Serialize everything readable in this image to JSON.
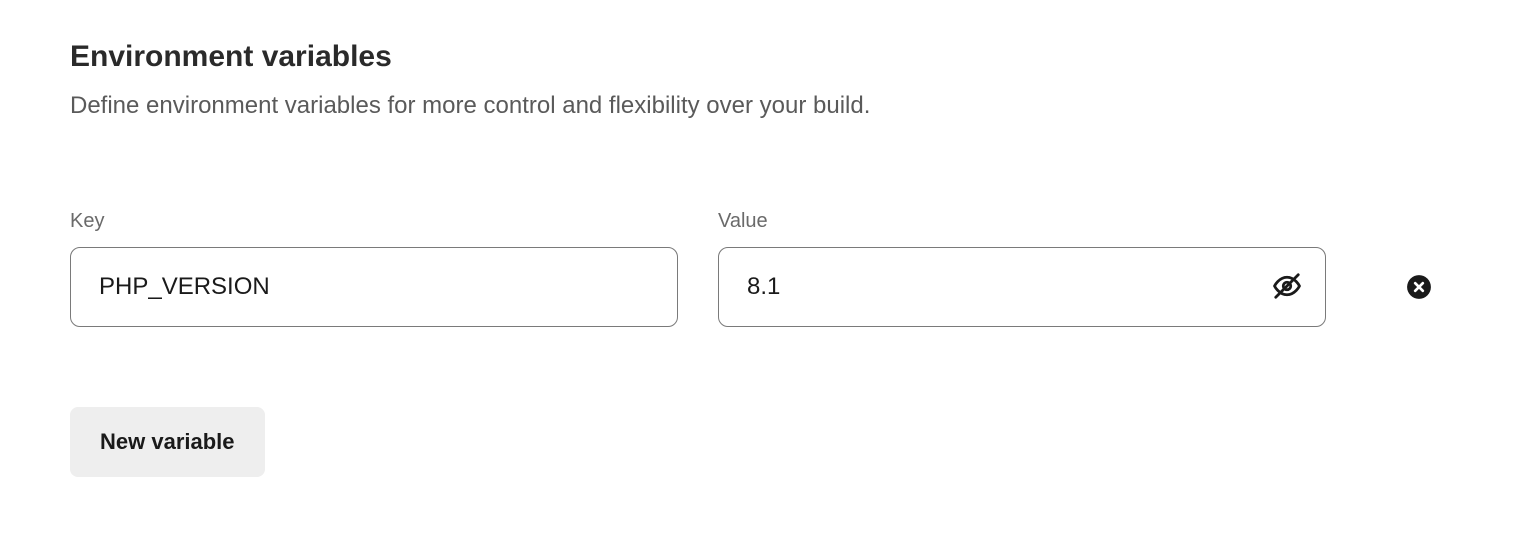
{
  "section": {
    "title": "Environment variables",
    "description": "Define environment variables for more control and flexibility over your build."
  },
  "labels": {
    "key": "Key",
    "value": "Value"
  },
  "variables": [
    {
      "key": "PHP_VERSION",
      "value": "8.1"
    }
  ],
  "buttons": {
    "new_variable": "New variable"
  },
  "icons": {
    "visibility_off": "visibility-off-icon",
    "remove": "remove-icon"
  }
}
